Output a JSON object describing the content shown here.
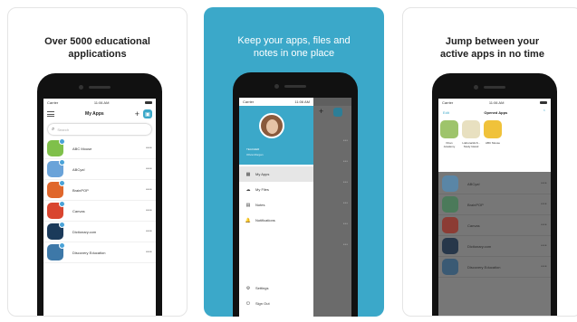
{
  "colors": {
    "accent": "#3ba8c9",
    "badge": "#4aa3d8"
  },
  "panel1": {
    "headline_line1": "Over 5000 educational",
    "headline_line2": "applications",
    "status_carrier": "Carrier",
    "status_time": "11:06 AM",
    "nav_title": "My Apps",
    "menu_icon": "hamburger-icon",
    "add_icon": "plus-icon",
    "search_placeholder": "Search",
    "apps": [
      {
        "name": "ABC Mouse",
        "color": "#7fc04a"
      },
      {
        "name": "ABCya!",
        "color": "#6aa3d9"
      },
      {
        "name": "BrainPOP",
        "color": "#e0672c"
      },
      {
        "name": "Canvas",
        "color": "#d9452f"
      },
      {
        "name": "Dictionary.com",
        "color": "#1b3a5a"
      },
      {
        "name": "Discovery Education",
        "color": "#3d78a8"
      }
    ]
  },
  "panel2": {
    "headline_line1": "Keep your apps, files and",
    "headline_line2": "notes in one place",
    "status_carrier": "Carrier",
    "status_time": "11:06 AM",
    "role": "TEACHER",
    "username": "Olivia Morgan",
    "menu": [
      {
        "label": "My Apps",
        "icon": "grid-icon",
        "glyph": "▦"
      },
      {
        "label": "My Files",
        "icon": "cloud-icon",
        "glyph": "☁"
      },
      {
        "label": "Notes",
        "icon": "notes-icon",
        "glyph": "▤"
      },
      {
        "label": "Notifications",
        "icon": "bell-icon",
        "glyph": "🔔"
      }
    ],
    "bottom_menu": [
      {
        "label": "Settings",
        "icon": "gear-icon",
        "glyph": "⚙"
      },
      {
        "label": "Sign Out",
        "icon": "power-icon",
        "glyph": "⏻"
      }
    ]
  },
  "panel3": {
    "headline_line1": "Jump between your",
    "headline_line2": "active apps in no time",
    "status_carrier": "Carrier",
    "status_time": "11:06 AM",
    "edit_label": "Edit",
    "opened_title": "Opened Apps",
    "opened": [
      {
        "name": "Khan Academy",
        "color": "#9ec46b"
      },
      {
        "name": "Liahona/HLS - Study Island",
        "color": "#e8e0c0"
      },
      {
        "name": "ABC Mouse",
        "color": "#f0c23a"
      }
    ],
    "apps": [
      {
        "name": "ABCya!",
        "color": "#5a86a6"
      },
      {
        "name": "BrainPOP",
        "color": "#4b7a5a"
      },
      {
        "name": "Canvas",
        "color": "#8c3c34"
      },
      {
        "name": "Dictionary.com",
        "color": "#27374a"
      },
      {
        "name": "Discovery Education",
        "color": "#3a5a74"
      }
    ]
  }
}
